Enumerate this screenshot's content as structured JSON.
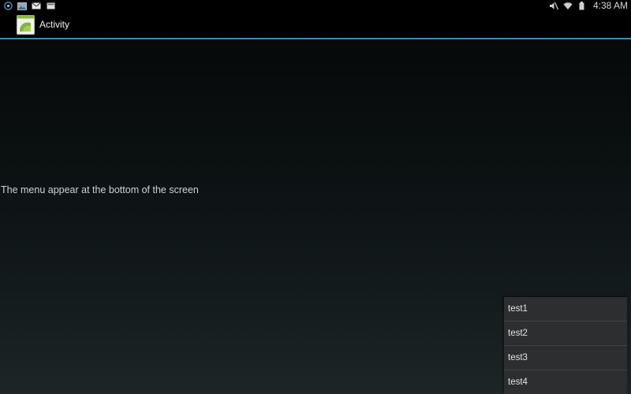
{
  "status_bar": {
    "time": "4:38 AM",
    "left_icons": [
      "sync-badge-icon",
      "gallery-notification-icon",
      "gmail-notification-icon",
      "email-notification-icon"
    ],
    "right_icons": [
      "mute-icon",
      "wifi-icon",
      "battery-icon"
    ]
  },
  "action_bar": {
    "title": "Activity",
    "icon": "android-app-icon",
    "accent_color": "#3a8fb4"
  },
  "main": {
    "message": "The menu appear at the bottom of the screen"
  },
  "options_menu": {
    "items": [
      {
        "label": "test1"
      },
      {
        "label": "test2"
      },
      {
        "label": "test3"
      },
      {
        "label": "test4"
      }
    ]
  }
}
